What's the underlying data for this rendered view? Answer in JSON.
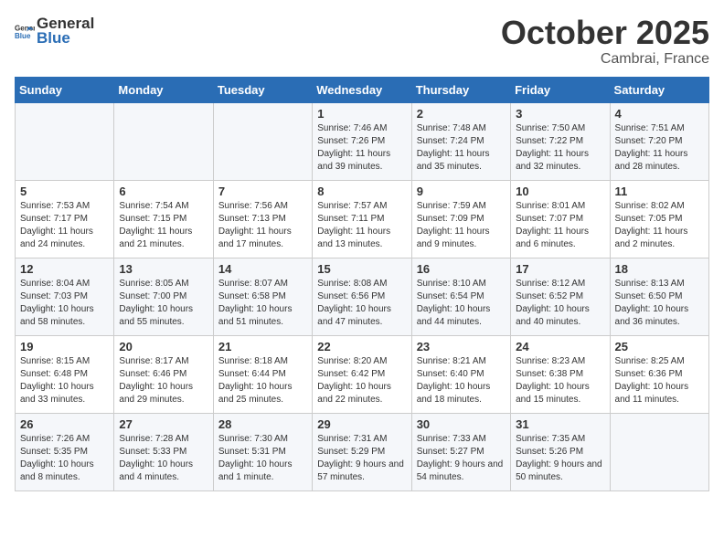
{
  "header": {
    "logo_general": "General",
    "logo_blue": "Blue",
    "month": "October 2025",
    "location": "Cambrai, France"
  },
  "weekdays": [
    "Sunday",
    "Monday",
    "Tuesday",
    "Wednesday",
    "Thursday",
    "Friday",
    "Saturday"
  ],
  "weeks": [
    [
      {
        "day": "",
        "sunrise": "",
        "sunset": "",
        "daylight": ""
      },
      {
        "day": "",
        "sunrise": "",
        "sunset": "",
        "daylight": ""
      },
      {
        "day": "",
        "sunrise": "",
        "sunset": "",
        "daylight": ""
      },
      {
        "day": "1",
        "sunrise": "Sunrise: 7:46 AM",
        "sunset": "Sunset: 7:26 PM",
        "daylight": "Daylight: 11 hours and 39 minutes."
      },
      {
        "day": "2",
        "sunrise": "Sunrise: 7:48 AM",
        "sunset": "Sunset: 7:24 PM",
        "daylight": "Daylight: 11 hours and 35 minutes."
      },
      {
        "day": "3",
        "sunrise": "Sunrise: 7:50 AM",
        "sunset": "Sunset: 7:22 PM",
        "daylight": "Daylight: 11 hours and 32 minutes."
      },
      {
        "day": "4",
        "sunrise": "Sunrise: 7:51 AM",
        "sunset": "Sunset: 7:20 PM",
        "daylight": "Daylight: 11 hours and 28 minutes."
      }
    ],
    [
      {
        "day": "5",
        "sunrise": "Sunrise: 7:53 AM",
        "sunset": "Sunset: 7:17 PM",
        "daylight": "Daylight: 11 hours and 24 minutes."
      },
      {
        "day": "6",
        "sunrise": "Sunrise: 7:54 AM",
        "sunset": "Sunset: 7:15 PM",
        "daylight": "Daylight: 11 hours and 21 minutes."
      },
      {
        "day": "7",
        "sunrise": "Sunrise: 7:56 AM",
        "sunset": "Sunset: 7:13 PM",
        "daylight": "Daylight: 11 hours and 17 minutes."
      },
      {
        "day": "8",
        "sunrise": "Sunrise: 7:57 AM",
        "sunset": "Sunset: 7:11 PM",
        "daylight": "Daylight: 11 hours and 13 minutes."
      },
      {
        "day": "9",
        "sunrise": "Sunrise: 7:59 AM",
        "sunset": "Sunset: 7:09 PM",
        "daylight": "Daylight: 11 hours and 9 minutes."
      },
      {
        "day": "10",
        "sunrise": "Sunrise: 8:01 AM",
        "sunset": "Sunset: 7:07 PM",
        "daylight": "Daylight: 11 hours and 6 minutes."
      },
      {
        "day": "11",
        "sunrise": "Sunrise: 8:02 AM",
        "sunset": "Sunset: 7:05 PM",
        "daylight": "Daylight: 11 hours and 2 minutes."
      }
    ],
    [
      {
        "day": "12",
        "sunrise": "Sunrise: 8:04 AM",
        "sunset": "Sunset: 7:03 PM",
        "daylight": "Daylight: 10 hours and 58 minutes."
      },
      {
        "day": "13",
        "sunrise": "Sunrise: 8:05 AM",
        "sunset": "Sunset: 7:00 PM",
        "daylight": "Daylight: 10 hours and 55 minutes."
      },
      {
        "day": "14",
        "sunrise": "Sunrise: 8:07 AM",
        "sunset": "Sunset: 6:58 PM",
        "daylight": "Daylight: 10 hours and 51 minutes."
      },
      {
        "day": "15",
        "sunrise": "Sunrise: 8:08 AM",
        "sunset": "Sunset: 6:56 PM",
        "daylight": "Daylight: 10 hours and 47 minutes."
      },
      {
        "day": "16",
        "sunrise": "Sunrise: 8:10 AM",
        "sunset": "Sunset: 6:54 PM",
        "daylight": "Daylight: 10 hours and 44 minutes."
      },
      {
        "day": "17",
        "sunrise": "Sunrise: 8:12 AM",
        "sunset": "Sunset: 6:52 PM",
        "daylight": "Daylight: 10 hours and 40 minutes."
      },
      {
        "day": "18",
        "sunrise": "Sunrise: 8:13 AM",
        "sunset": "Sunset: 6:50 PM",
        "daylight": "Daylight: 10 hours and 36 minutes."
      }
    ],
    [
      {
        "day": "19",
        "sunrise": "Sunrise: 8:15 AM",
        "sunset": "Sunset: 6:48 PM",
        "daylight": "Daylight: 10 hours and 33 minutes."
      },
      {
        "day": "20",
        "sunrise": "Sunrise: 8:17 AM",
        "sunset": "Sunset: 6:46 PM",
        "daylight": "Daylight: 10 hours and 29 minutes."
      },
      {
        "day": "21",
        "sunrise": "Sunrise: 8:18 AM",
        "sunset": "Sunset: 6:44 PM",
        "daylight": "Daylight: 10 hours and 25 minutes."
      },
      {
        "day": "22",
        "sunrise": "Sunrise: 8:20 AM",
        "sunset": "Sunset: 6:42 PM",
        "daylight": "Daylight: 10 hours and 22 minutes."
      },
      {
        "day": "23",
        "sunrise": "Sunrise: 8:21 AM",
        "sunset": "Sunset: 6:40 PM",
        "daylight": "Daylight: 10 hours and 18 minutes."
      },
      {
        "day": "24",
        "sunrise": "Sunrise: 8:23 AM",
        "sunset": "Sunset: 6:38 PM",
        "daylight": "Daylight: 10 hours and 15 minutes."
      },
      {
        "day": "25",
        "sunrise": "Sunrise: 8:25 AM",
        "sunset": "Sunset: 6:36 PM",
        "daylight": "Daylight: 10 hours and 11 minutes."
      }
    ],
    [
      {
        "day": "26",
        "sunrise": "Sunrise: 7:26 AM",
        "sunset": "Sunset: 5:35 PM",
        "daylight": "Daylight: 10 hours and 8 minutes."
      },
      {
        "day": "27",
        "sunrise": "Sunrise: 7:28 AM",
        "sunset": "Sunset: 5:33 PM",
        "daylight": "Daylight: 10 hours and 4 minutes."
      },
      {
        "day": "28",
        "sunrise": "Sunrise: 7:30 AM",
        "sunset": "Sunset: 5:31 PM",
        "daylight": "Daylight: 10 hours and 1 minute."
      },
      {
        "day": "29",
        "sunrise": "Sunrise: 7:31 AM",
        "sunset": "Sunset: 5:29 PM",
        "daylight": "Daylight: 9 hours and 57 minutes."
      },
      {
        "day": "30",
        "sunrise": "Sunrise: 7:33 AM",
        "sunset": "Sunset: 5:27 PM",
        "daylight": "Daylight: 9 hours and 54 minutes."
      },
      {
        "day": "31",
        "sunrise": "Sunrise: 7:35 AM",
        "sunset": "Sunset: 5:26 PM",
        "daylight": "Daylight: 9 hours and 50 minutes."
      },
      {
        "day": "",
        "sunrise": "",
        "sunset": "",
        "daylight": ""
      }
    ]
  ]
}
